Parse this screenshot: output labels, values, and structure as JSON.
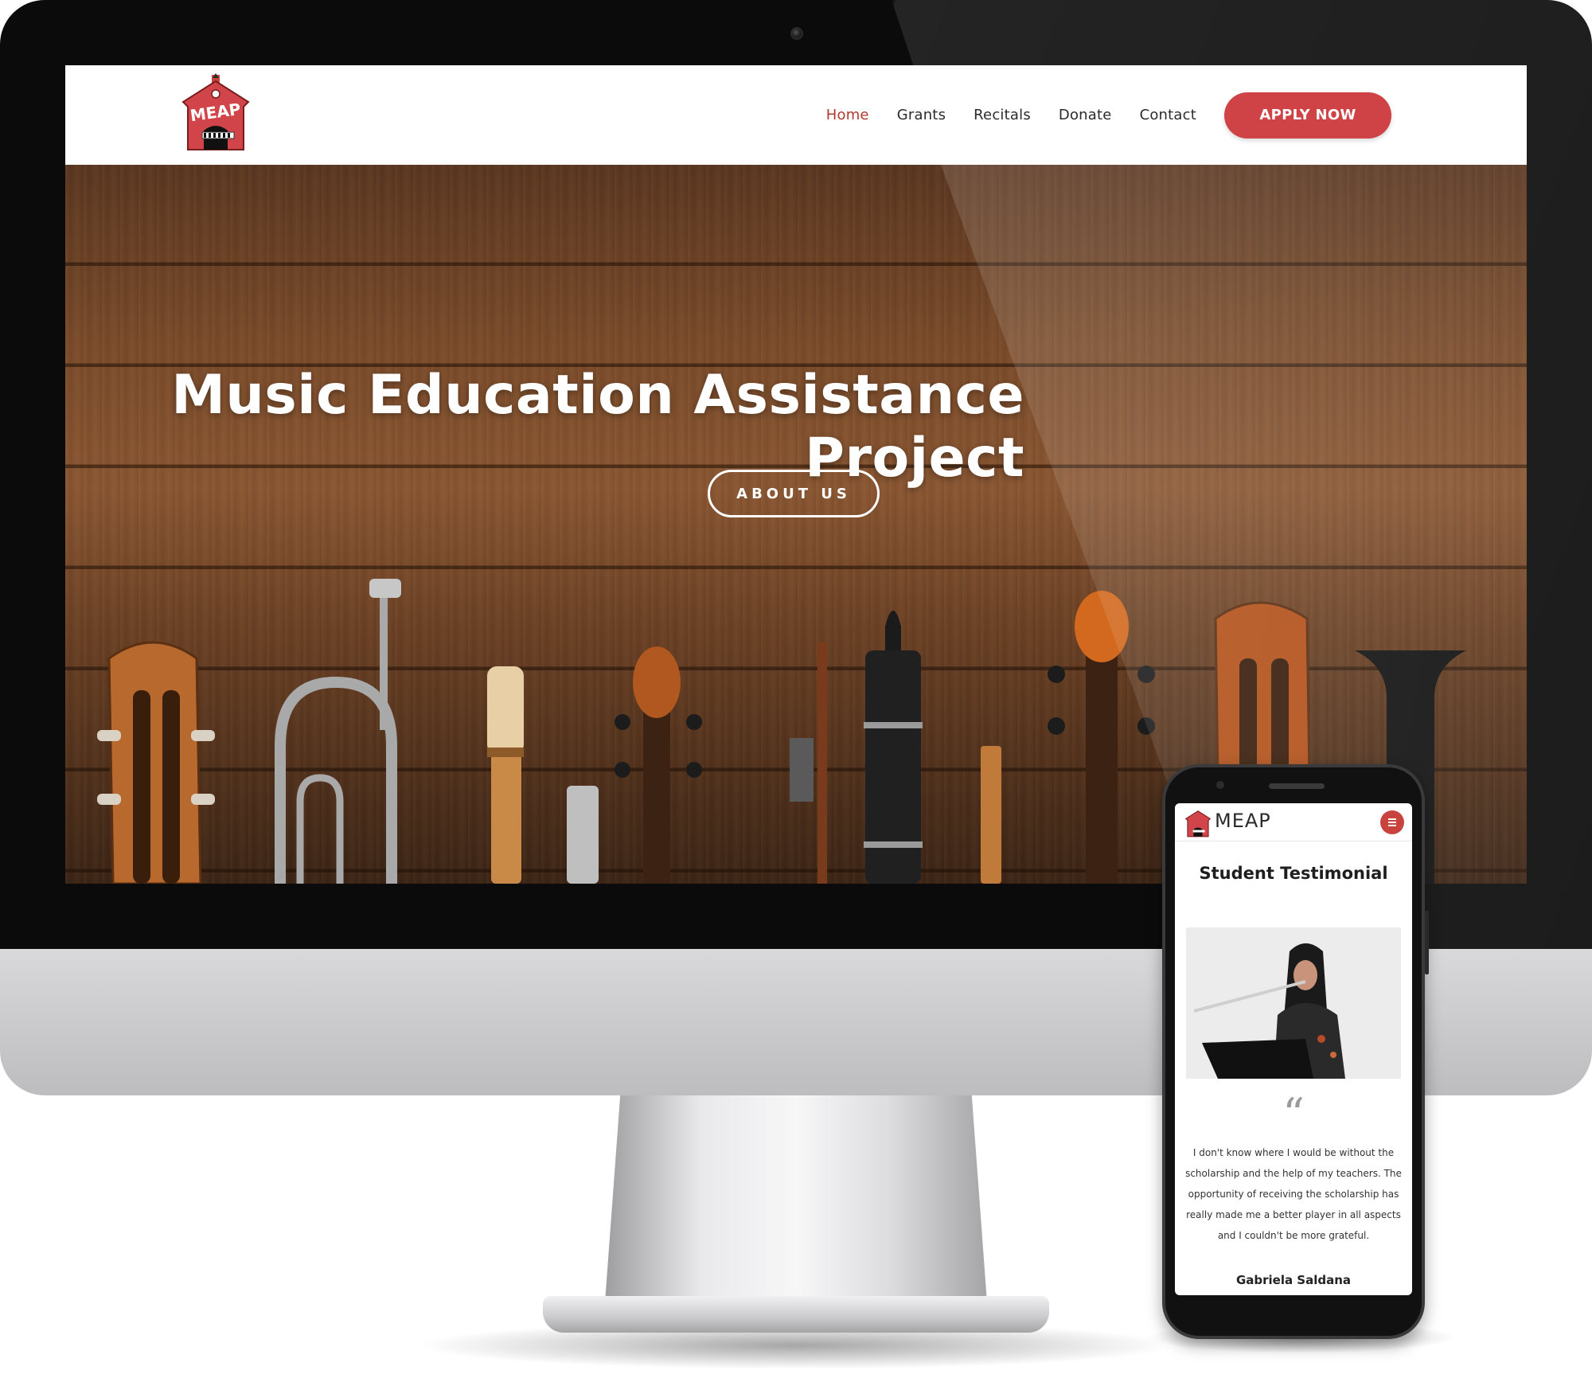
{
  "desktop": {
    "header": {
      "logo_text": "MEAP",
      "nav": [
        {
          "label": "Home",
          "active": true
        },
        {
          "label": "Grants",
          "active": false
        },
        {
          "label": "Recitals",
          "active": false
        },
        {
          "label": "Donate",
          "active": false
        },
        {
          "label": "Contact",
          "active": false
        }
      ],
      "apply_label": "APPLY NOW"
    },
    "hero": {
      "title": "Music Education Assistance Project",
      "about_label": "ABOUT US"
    }
  },
  "mobile": {
    "brand": "MEAP",
    "section_title": "Student Testimonial",
    "quote_mark": "“",
    "quote": "I don't know where I would be without the scholarship and the help of my teachers. The opportunity of receiving the scholarship has really made me a better player in all aspects and I couldn't be more grateful.",
    "author": "Gabriela Saldana"
  },
  "colors": {
    "accent": "#cf4347",
    "nav_active": "#b03a2e",
    "hero_wood": "#7a4b2a"
  },
  "icons": {
    "menu": "hamburger-menu-icon",
    "quote": "quote-icon",
    "camera": "camera-icon"
  }
}
